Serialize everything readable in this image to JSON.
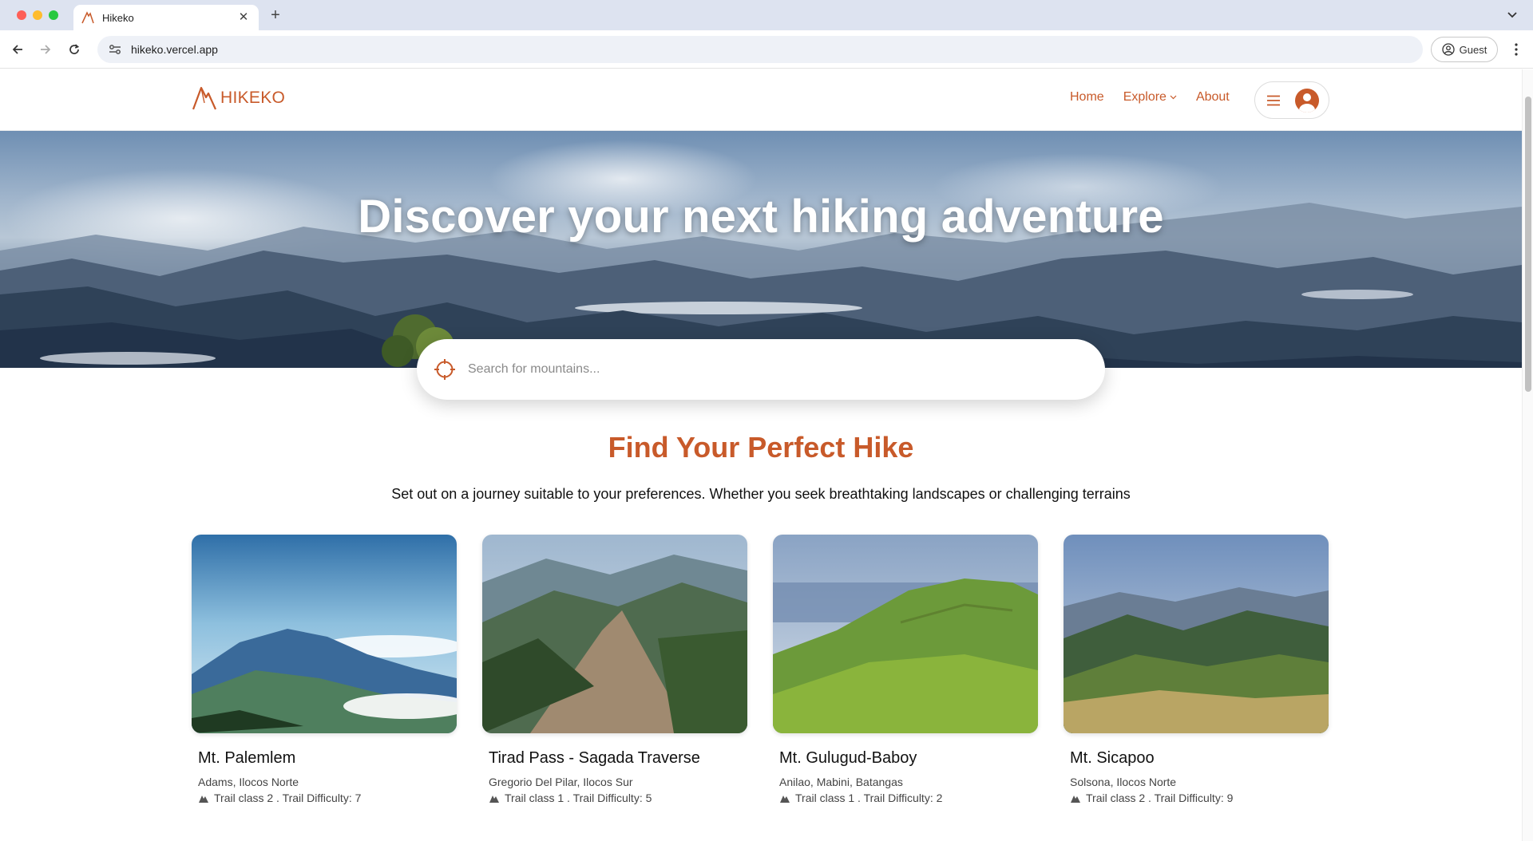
{
  "browser": {
    "tab_title": "Hikeko",
    "url": "hikeko.vercel.app",
    "profile_label": "Guest"
  },
  "site": {
    "logo_text": "HIKEKO",
    "nav": {
      "home": "Home",
      "explore": "Explore",
      "about": "About"
    }
  },
  "hero": {
    "title": "Discover your next hiking adventure",
    "search_placeholder": "Search for mountains..."
  },
  "section": {
    "title": "Find Your Perfect Hike",
    "subtitle": "Set out on a journey suitable to your preferences. Whether you seek breathtaking landscapes or challenging terrains"
  },
  "hikes": [
    {
      "name": "Mt. Palemlem",
      "location": "Adams, Ilocos Norte",
      "meta": "Trail class 2 . Trail Difficulty: 7",
      "trail_class": 2,
      "difficulty": 7
    },
    {
      "name": "Tirad Pass - Sagada Traverse",
      "location": "Gregorio Del Pilar, Ilocos Sur",
      "meta": "Trail class 1 . Trail Difficulty: 5",
      "trail_class": 1,
      "difficulty": 5
    },
    {
      "name": "Mt. Gulugud-Baboy",
      "location": "Anilao, Mabini, Batangas",
      "meta": "Trail class 1 . Trail Difficulty: 2",
      "trail_class": 1,
      "difficulty": 2
    },
    {
      "name": "Mt. Sicapoo",
      "location": "Solsona, Ilocos Norte",
      "meta": "Trail class 2 . Trail Difficulty: 9",
      "trail_class": 2,
      "difficulty": 9
    }
  ],
  "colors": {
    "brand": "#c85a2a",
    "tabstrip": "#dde3f0"
  }
}
